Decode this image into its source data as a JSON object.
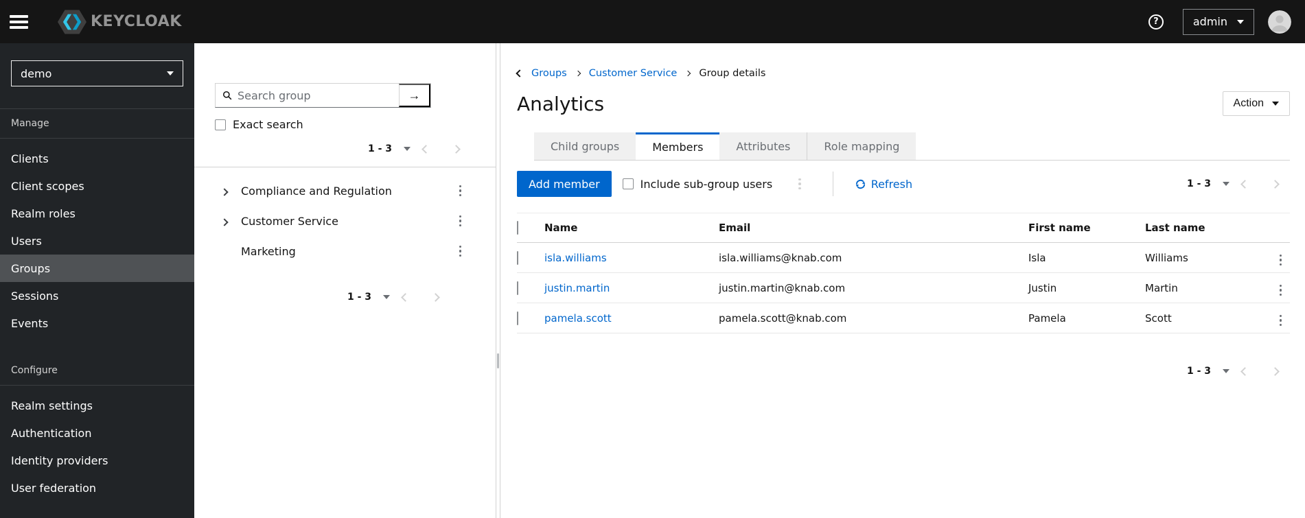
{
  "header": {
    "menu_icon": "hamburger-icon",
    "brand": "KEYCLOAK",
    "help_icon": "question-circle-icon",
    "user": {
      "label": "admin"
    },
    "avatar_icon": "user-avatar-icon"
  },
  "sidebar": {
    "realm_selector": {
      "value": "demo"
    },
    "sections": [
      {
        "label": "Manage",
        "items": [
          {
            "label": "Clients",
            "active": false
          },
          {
            "label": "Client scopes",
            "active": false
          },
          {
            "label": "Realm roles",
            "active": false
          },
          {
            "label": "Users",
            "active": false
          },
          {
            "label": "Groups",
            "active": true
          },
          {
            "label": "Sessions",
            "active": false
          },
          {
            "label": "Events",
            "active": false
          }
        ]
      },
      {
        "label": "Configure",
        "items": [
          {
            "label": "Realm settings",
            "active": false
          },
          {
            "label": "Authentication",
            "active": false
          },
          {
            "label": "Identity providers",
            "active": false
          },
          {
            "label": "User federation",
            "active": false
          }
        ]
      }
    ]
  },
  "groups_panel": {
    "search": {
      "placeholder": "Search group",
      "icon": "search-icon",
      "submit_icon": "arrow-right-icon",
      "submit_glyph": "→"
    },
    "exact_search_label": "Exact search",
    "pagination_top": {
      "range": "1 - 3"
    },
    "tree": [
      {
        "label": "Compliance and Regulation",
        "expandable": true
      },
      {
        "label": "Customer Service",
        "expandable": true
      },
      {
        "label": "Marketing",
        "expandable": false
      }
    ],
    "pagination_bottom": {
      "range": "1 - 3"
    }
  },
  "main": {
    "breadcrumb": {
      "back_icon": "angle-left-icon",
      "items": [
        {
          "label": "Groups",
          "link": true
        },
        {
          "label": "Customer Service",
          "link": true
        },
        {
          "label": "Group details",
          "link": false
        }
      ]
    },
    "title": "Analytics",
    "action_button": {
      "label": "Action"
    },
    "tabs": [
      {
        "label": "Child groups",
        "active": false
      },
      {
        "label": "Members",
        "active": true
      },
      {
        "label": "Attributes",
        "active": false
      },
      {
        "label": "Role mapping",
        "active": false
      }
    ],
    "toolbar": {
      "add_member_label": "Add member",
      "include_subgroups_label": "Include sub-group users",
      "kebab_icon": "kebab-menu-icon",
      "refresh_icon": "sync-icon",
      "refresh_label": "Refresh",
      "pagination": {
        "range": "1 - 3"
      }
    },
    "table": {
      "columns": {
        "name": "Name",
        "email": "Email",
        "first": "First name",
        "last": "Last name"
      },
      "rows": [
        {
          "name": "isla.williams",
          "email": "isla.williams@knab.com",
          "first": "Isla",
          "last": "Williams"
        },
        {
          "name": "justin.martin",
          "email": "justin.martin@knab.com",
          "first": "Justin",
          "last": "Martin"
        },
        {
          "name": "pamela.scott",
          "email": "pamela.scott@knab.com",
          "first": "Pamela",
          "last": "Scott"
        }
      ]
    },
    "pagination_bottom": {
      "range": "1 - 3"
    }
  },
  "colors": {
    "accent_blue": "#0066cc",
    "masthead_bg": "#151515",
    "sidebar_bg": "#212427",
    "sidebar_active_bg": "#4f5255",
    "border": "#d2d2d2",
    "muted_text": "#6a6e73",
    "disabled": "#d2d2d2",
    "tab_inactive_bg": "#f0f0f0",
    "logo_cyan": "#33c6e9",
    "logo_blue": "#0e9dc9"
  }
}
